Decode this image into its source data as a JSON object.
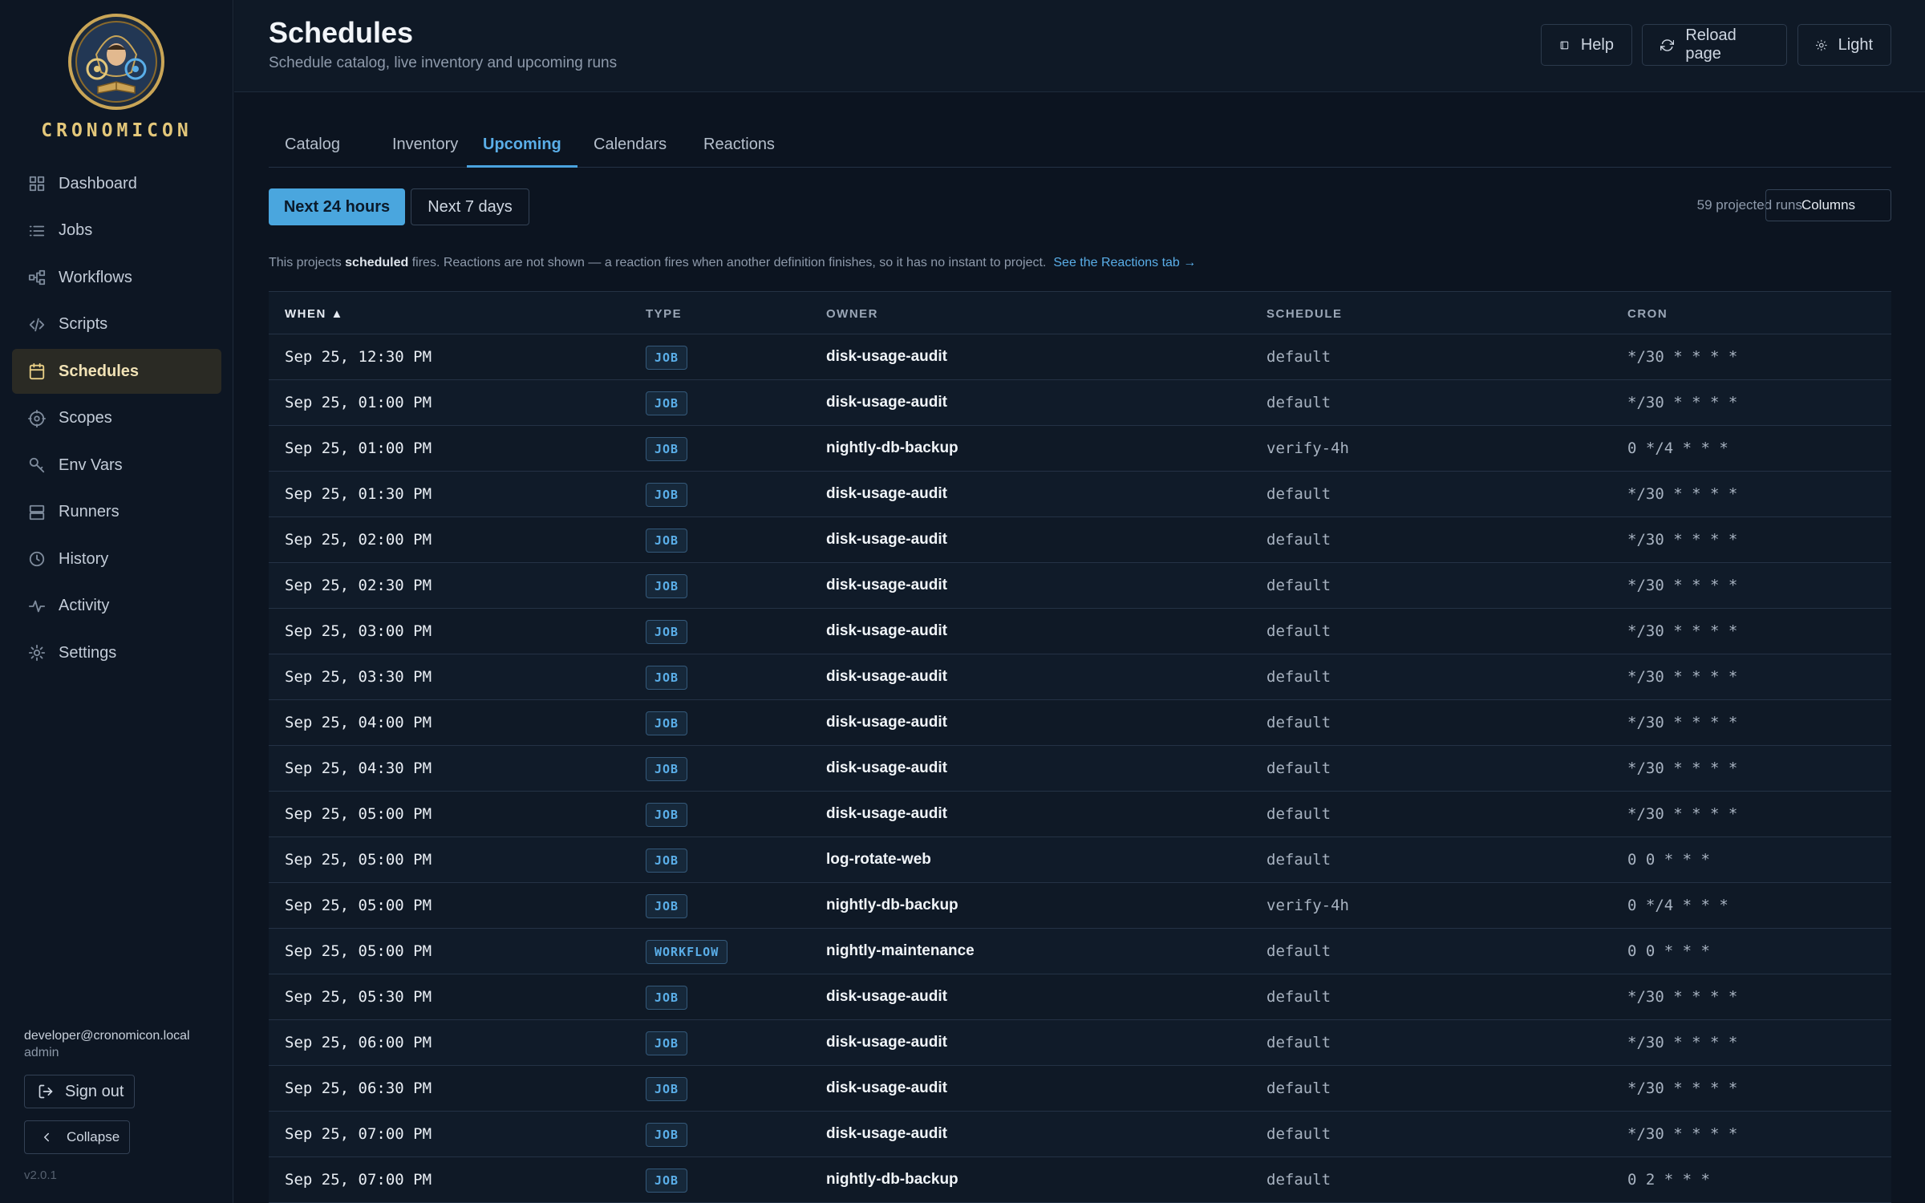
{
  "sidebar": {
    "brand": "CRONOMICON",
    "items": [
      {
        "label": "Dashboard",
        "icon": "grid-icon"
      },
      {
        "label": "Jobs",
        "icon": "list-icon"
      },
      {
        "label": "Workflows",
        "icon": "workflow-icon"
      },
      {
        "label": "Scripts",
        "icon": "code-icon"
      },
      {
        "label": "Schedules",
        "icon": "calendar-icon",
        "active": true
      },
      {
        "label": "Scopes",
        "icon": "target-icon"
      },
      {
        "label": "Env Vars",
        "icon": "key-icon"
      },
      {
        "label": "Runners",
        "icon": "server-icon"
      },
      {
        "label": "History",
        "icon": "clock-icon"
      },
      {
        "label": "Activity",
        "icon": "activity-icon"
      },
      {
        "label": "Settings",
        "icon": "gear-icon"
      }
    ],
    "user_email": "developer@cronomicon.local",
    "user_role": "admin",
    "signout_label": "Sign out",
    "collapse_label": "Collapse",
    "version": "v2.0.1"
  },
  "header": {
    "title": "Schedules",
    "subtitle": "Schedule catalog, live inventory and upcoming runs",
    "help_label": "Help",
    "reload_label": "Reload page",
    "theme_label": "Light"
  },
  "tabs": [
    {
      "label": "Catalog"
    },
    {
      "label": "Inventory"
    },
    {
      "label": "Upcoming",
      "active": true
    },
    {
      "label": "Calendars"
    },
    {
      "label": "Reactions"
    }
  ],
  "range": {
    "next24": "Next 24 hours",
    "next7": "Next 7 days"
  },
  "projected_runs": "59 projected runs",
  "columns_label": "Columns",
  "note": {
    "prefix": "This projects ",
    "bold": "scheduled",
    "suffix": " fires. Reactions are not shown — a reaction fires when another definition finishes, so it has no instant to project.",
    "link": "See the Reactions tab →"
  },
  "table": {
    "headers": {
      "when": "WHEN ▲",
      "type": "TYPE",
      "owner": "OWNER",
      "schedule": "SCHEDULE",
      "cron": "CRON"
    },
    "rows": [
      {
        "when": "Sep 25, 12:30 PM",
        "type": "JOB",
        "owner": "disk-usage-audit",
        "schedule": "default",
        "cron": "*/30 * * * *"
      },
      {
        "when": "Sep 25, 01:00 PM",
        "type": "JOB",
        "owner": "disk-usage-audit",
        "schedule": "default",
        "cron": "*/30 * * * *"
      },
      {
        "when": "Sep 25, 01:00 PM",
        "type": "JOB",
        "owner": "nightly-db-backup",
        "schedule": "verify-4h",
        "cron": "0 */4 * * *"
      },
      {
        "when": "Sep 25, 01:30 PM",
        "type": "JOB",
        "owner": "disk-usage-audit",
        "schedule": "default",
        "cron": "*/30 * * * *"
      },
      {
        "when": "Sep 25, 02:00 PM",
        "type": "JOB",
        "owner": "disk-usage-audit",
        "schedule": "default",
        "cron": "*/30 * * * *"
      },
      {
        "when": "Sep 25, 02:30 PM",
        "type": "JOB",
        "owner": "disk-usage-audit",
        "schedule": "default",
        "cron": "*/30 * * * *"
      },
      {
        "when": "Sep 25, 03:00 PM",
        "type": "JOB",
        "owner": "disk-usage-audit",
        "schedule": "default",
        "cron": "*/30 * * * *"
      },
      {
        "when": "Sep 25, 03:30 PM",
        "type": "JOB",
        "owner": "disk-usage-audit",
        "schedule": "default",
        "cron": "*/30 * * * *"
      },
      {
        "when": "Sep 25, 04:00 PM",
        "type": "JOB",
        "owner": "disk-usage-audit",
        "schedule": "default",
        "cron": "*/30 * * * *"
      },
      {
        "when": "Sep 25, 04:30 PM",
        "type": "JOB",
        "owner": "disk-usage-audit",
        "schedule": "default",
        "cron": "*/30 * * * *"
      },
      {
        "when": "Sep 25, 05:00 PM",
        "type": "JOB",
        "owner": "disk-usage-audit",
        "schedule": "default",
        "cron": "*/30 * * * *"
      },
      {
        "when": "Sep 25, 05:00 PM",
        "type": "JOB",
        "owner": "log-rotate-web",
        "schedule": "default",
        "cron": "0 0 * * *"
      },
      {
        "when": "Sep 25, 05:00 PM",
        "type": "JOB",
        "owner": "nightly-db-backup",
        "schedule": "verify-4h",
        "cron": "0 */4 * * *"
      },
      {
        "when": "Sep 25, 05:00 PM",
        "type": "WORKFLOW",
        "owner": "nightly-maintenance",
        "schedule": "default",
        "cron": "0 0 * * *"
      },
      {
        "when": "Sep 25, 05:30 PM",
        "type": "JOB",
        "owner": "disk-usage-audit",
        "schedule": "default",
        "cron": "*/30 * * * *"
      },
      {
        "when": "Sep 25, 06:00 PM",
        "type": "JOB",
        "owner": "disk-usage-audit",
        "schedule": "default",
        "cron": "*/30 * * * *"
      },
      {
        "when": "Sep 25, 06:30 PM",
        "type": "JOB",
        "owner": "disk-usage-audit",
        "schedule": "default",
        "cron": "*/30 * * * *"
      },
      {
        "when": "Sep 25, 07:00 PM",
        "type": "JOB",
        "owner": "disk-usage-audit",
        "schedule": "default",
        "cron": "*/30 * * * *"
      },
      {
        "when": "Sep 25, 07:00 PM",
        "type": "JOB",
        "owner": "nightly-db-backup",
        "schedule": "default",
        "cron": "0 2 * * *"
      }
    ]
  },
  "colors": {
    "accent": "#4aa6de",
    "brand_gold": "#e3c77a",
    "background": "#0c1420"
  }
}
